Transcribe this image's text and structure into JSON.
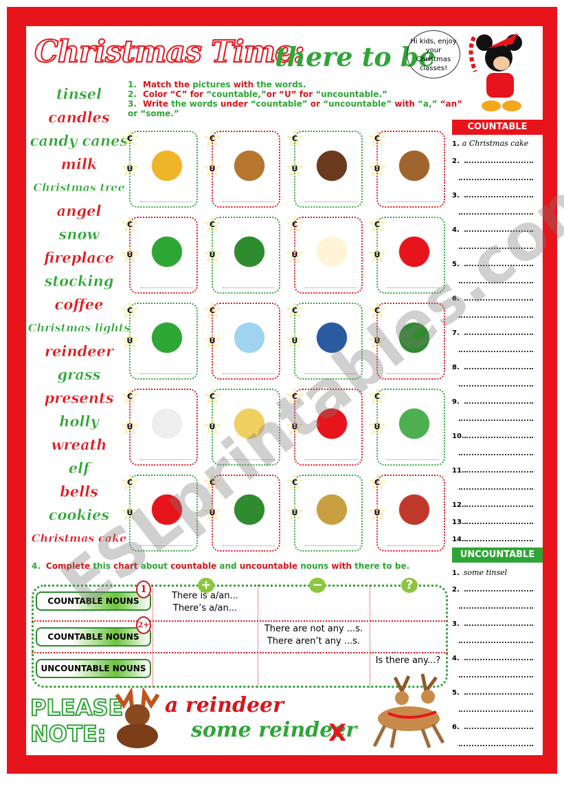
{
  "title": {
    "main": "Christmas Time:",
    "sub": "there to be"
  },
  "bubble": "Hi kids, enjoy your Christmas classes!",
  "instructions": [
    {
      "n": "1.",
      "parts": [
        [
          "red",
          "Match the "
        ],
        [
          "grn",
          "pictures "
        ],
        [
          "red",
          "with "
        ],
        [
          "grn",
          "the words."
        ]
      ]
    },
    {
      "n": "2.",
      "parts": [
        [
          "red",
          "Color “C” for "
        ],
        [
          "grn",
          "“countable,”"
        ],
        [
          "red",
          "or “U” for "
        ],
        [
          "grn",
          "“uncountable.”"
        ]
      ]
    },
    {
      "n": "3.",
      "parts": [
        [
          "red",
          "Write "
        ],
        [
          "grn",
          "the words "
        ],
        [
          "red",
          "under "
        ],
        [
          "grn",
          "“countable” "
        ],
        [
          "red",
          "or "
        ],
        [
          "grn",
          "“uncountable” "
        ],
        [
          "red",
          "with "
        ],
        [
          "grn",
          "“a,” "
        ],
        [
          "red",
          "“an” "
        ],
        [
          "grn",
          "or “some.”"
        ]
      ]
    }
  ],
  "words": [
    "tinsel",
    "candles",
    "candy canes",
    "milk",
    "Christmas tree",
    "angel",
    "snow",
    "fireplace",
    "stocking",
    "coffee",
    "Christmas lights",
    "reindeer",
    "grass",
    "presents",
    "holly",
    "wreath",
    "elf",
    "bells",
    "cookies",
    "Christmas cake"
  ],
  "star_labels": {
    "c": "C",
    "u": "U"
  },
  "pictures": [
    "bells",
    "cookies",
    "christmas-cake",
    "reindeer",
    "presents",
    "holly",
    "angel",
    "candy-canes",
    "elf",
    "snow",
    "coffee",
    "wreath",
    "milk",
    "candles",
    "stocking",
    "grass",
    "christmas-lights",
    "christmas-tree",
    "tinsel",
    "fireplace"
  ],
  "countable": {
    "header": "COUNTABLE",
    "items": [
      "1.",
      "2.",
      "3.",
      "4.",
      "5.",
      "6.",
      "7.",
      "8.",
      "9.",
      "10.",
      "11.",
      "12.",
      "13.",
      "14."
    ],
    "example": "a Christmas cake"
  },
  "uncountable": {
    "header": "UNCOUNTABLE",
    "items": [
      "1.",
      "2.",
      "3.",
      "4.",
      "5.",
      "6."
    ],
    "example": "some tinsel"
  },
  "task4": {
    "n": "4.",
    "parts": [
      [
        "red",
        "Complete "
      ],
      [
        "grn",
        "this "
      ],
      [
        "red",
        "chart "
      ],
      [
        "grn",
        "about "
      ],
      [
        "red",
        "countable "
      ],
      [
        "grn",
        "and "
      ],
      [
        "red",
        "uncountable "
      ],
      [
        "grn",
        "nouns "
      ],
      [
        "red",
        "with "
      ],
      [
        "grn",
        "there to be."
      ]
    ]
  },
  "chart": {
    "symbols": [
      "+",
      "−",
      "?"
    ],
    "rows": [
      {
        "label": "COUNTABLE NOUNS",
        "badge": "1",
        "plus": [
          "There is a/an...",
          "There’s a/an..."
        ],
        "minus": [],
        "q": []
      },
      {
        "label": "COUNTABLE NOUNS",
        "badge": "2+",
        "plus": [],
        "minus": [
          "There are not any ...s.",
          "There aren’t any ...s."
        ],
        "q": []
      },
      {
        "label": "UNCOUNTABLE NOUNS",
        "badge": "",
        "plus": [],
        "minus": [],
        "q": [
          "Is there any...?"
        ]
      }
    ]
  },
  "note": {
    "please": "PLEASE",
    "note": "NOTE:",
    "example1": "a reindeer",
    "example2": "some reindeer",
    "wrong": "X"
  },
  "watermark": "ESLprintables.com",
  "colors": {
    "red": "#e8141b",
    "green": "#2ea636"
  }
}
